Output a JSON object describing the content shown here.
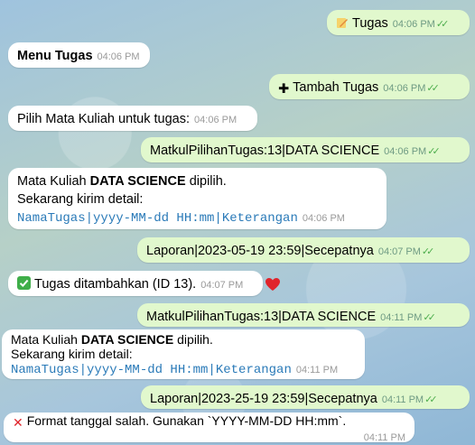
{
  "messages": [
    {
      "dir": "out",
      "text": "Tugas",
      "time": "04:06 PM"
    },
    {
      "dir": "in",
      "text": "Menu Tugas",
      "time": "04:06 PM"
    },
    {
      "dir": "out",
      "text": "Tambah Tugas",
      "time": "04:06 PM"
    },
    {
      "dir": "in",
      "text": "Pilih Mata Kuliah untuk tugas:",
      "time": "04:06 PM"
    },
    {
      "dir": "out",
      "text": "MatkulPilihanTugas:13|DATA SCIENCE",
      "time": "04:06 PM"
    },
    {
      "dir": "in",
      "line1_pre": "Mata Kuliah ",
      "line1_bold": "DATA SCIENCE",
      "line1_post": " dipilih.",
      "line2": "Sekarang kirim detail:",
      "line3": "NamaTugas|yyyy-MM-dd HH:mm|Keterangan",
      "time": "04:06 PM"
    },
    {
      "dir": "out",
      "text": "Laporan|2023-05-19 23:59|Secepatnya",
      "time": "04:07 PM"
    },
    {
      "dir": "in",
      "text": "Tugas ditambahkan (ID 13).",
      "time": "04:07 PM"
    },
    {
      "dir": "out",
      "text": "MatkulPilihanTugas:13|DATA SCIENCE",
      "time": "04:11 PM"
    },
    {
      "dir": "in",
      "line1_pre": "Mata Kuliah ",
      "line1_bold": "DATA SCIENCE",
      "line1_post": " dipilih.",
      "line2": "Sekarang kirim detail:",
      "line3": "NamaTugas|yyyy-MM-dd HH:mm|Keterangan",
      "time": "04:11 PM"
    },
    {
      "dir": "out",
      "text": "Laporan|2023-25-19 23:59|Secepatnya",
      "time": "04:11 PM"
    },
    {
      "dir": "in",
      "text": "Format tanggal salah. Gunakan `YYYY-MM-DD HH:mm`.",
      "time": "04:11 PM"
    }
  ],
  "icons": {
    "tugas": "pencil-memo-icon",
    "tambah": "plus-icon",
    "success": "check-mark-icon",
    "error": "cross-mark-icon",
    "reaction": "heart-icon",
    "read": "double-check-icon"
  },
  "colors": {
    "outgoing_bubble": "#e1f8cd",
    "incoming_bubble": "#ffffff",
    "mono_text": "#2a7ab8",
    "read_check": "#4fae4e"
  }
}
